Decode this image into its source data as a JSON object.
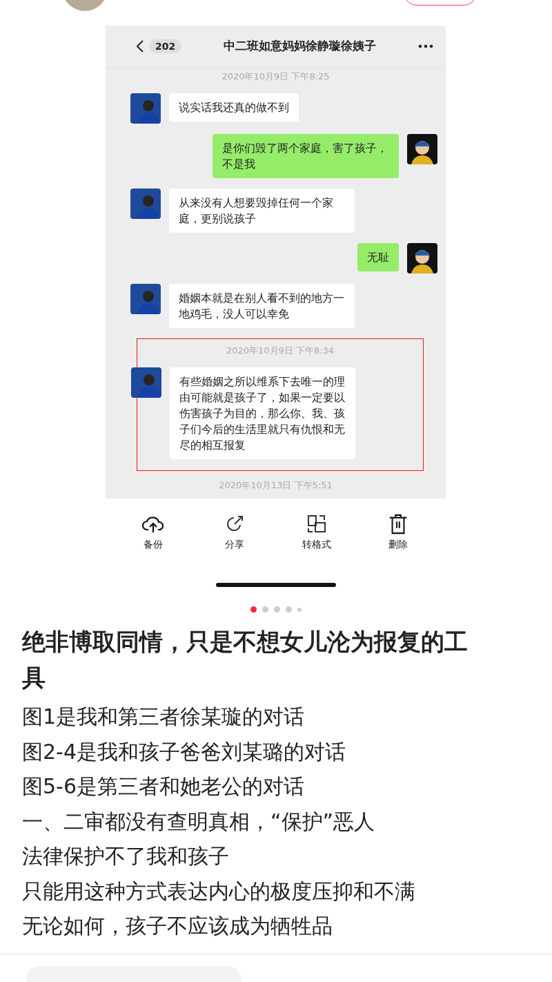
{
  "chat_screenshot": {
    "back_count": "202",
    "title": "中二班如意妈妈徐静璇徐姨子",
    "items": [
      {
        "kind": "time",
        "text": "2020年10月9日 下午8:25",
        "boxed": false
      },
      {
        "kind": "message",
        "outgoing": false,
        "text": "说实话我还真的做不到",
        "boxed": false
      },
      {
        "kind": "message",
        "outgoing": true,
        "text": "是你们毁了两个家庭，害了孩子，不是我",
        "boxed": false
      },
      {
        "kind": "message",
        "outgoing": false,
        "text": "从来没有人想要毁掉任何一个家庭，更别说孩子",
        "boxed": false
      },
      {
        "kind": "message",
        "outgoing": true,
        "text": "无耻",
        "boxed": false
      },
      {
        "kind": "message",
        "outgoing": false,
        "text": "婚姻本就是在别人看不到的地方一地鸡毛，没人可以幸免",
        "boxed": false
      },
      {
        "kind": "time",
        "text": "2020年10月9日 下午8:34",
        "boxed": true
      },
      {
        "kind": "message",
        "outgoing": false,
        "text": "有些婚姻之所以维系下去唯一的理由可能就是孩子了，如果一定要以伤害孩子为目的，那么你、我、孩子们今后的生活里就只有仇恨和无尽的相互报复",
        "boxed": true
      },
      {
        "kind": "time",
        "text": "2020年10月13日 下午5:51",
        "boxed": false
      }
    ]
  },
  "actions": [
    {
      "kind": "upload",
      "label": "备份"
    },
    {
      "kind": "share",
      "label": "分享"
    },
    {
      "kind": "convert",
      "label": "转格式"
    },
    {
      "kind": "delete",
      "label": "删除"
    }
  ],
  "carousel": {
    "dots": [
      {
        "selected": true,
        "kind": "dot"
      },
      {
        "selected": false,
        "kind": "dot"
      },
      {
        "selected": false,
        "kind": "dot"
      },
      {
        "selected": false,
        "kind": "dot"
      },
      {
        "selected": false,
        "kind": "small"
      }
    ]
  },
  "post": {
    "title": "绝非博取同情，只是不想女儿沦为报复的工具",
    "lines": [
      "图1是我和第三者徐某璇的对话",
      "图2-4是我和孩子爸爸刘某璐的对话",
      "图5-6是第三者和她老公的对话",
      "一、二审都没有查明真相，“保护”恶人",
      "法律保护不了我和孩子",
      "只能用这种方式表达内心的极度压抑和不满",
      "无论如何，孩子不应该成为牺牲品"
    ]
  }
}
